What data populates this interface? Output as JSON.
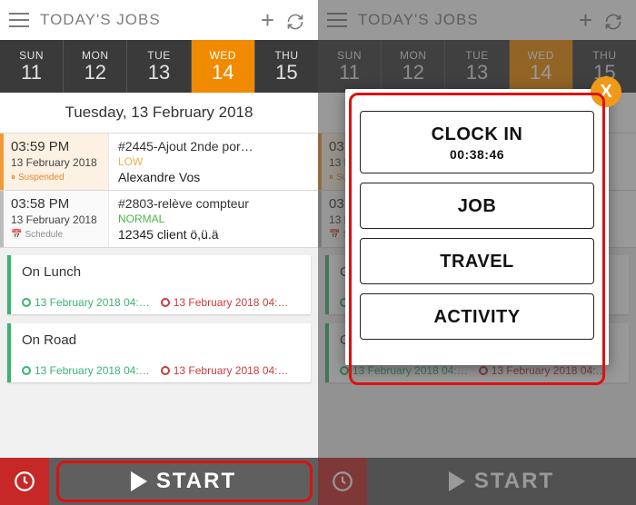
{
  "header": {
    "title": "TODAY'S JOBS"
  },
  "days": [
    {
      "name": "SUN",
      "num": "11"
    },
    {
      "name": "MON",
      "num": "12"
    },
    {
      "name": "TUE",
      "num": "13"
    },
    {
      "name": "WED",
      "num": "14"
    },
    {
      "name": "THU",
      "num": "15"
    }
  ],
  "selected_day_index": 3,
  "date_heading": "Tuesday, 13 February 2018",
  "jobs": [
    {
      "time": "03:59 PM",
      "date": "13 February 2018",
      "status": "Suspended",
      "title": "#2445-Ajout 2nde por…",
      "priority": "LOW",
      "client": "Alexandre Vos"
    },
    {
      "time": "03:58 PM",
      "date": "13 February 2018",
      "status": "Schedule",
      "title": "#2803-relève compteur",
      "priority": "NORMAL",
      "client": "12345 client ö,ü.ä"
    }
  ],
  "activities": [
    {
      "label": "On Lunch",
      "start": "13 February 2018 04:…",
      "end": "13 February 2018 04:…"
    },
    {
      "label": "On Road",
      "start": "13 February 2018 04:…",
      "end": "13 February 2018 04:…"
    }
  ],
  "footer": {
    "start": "START"
  },
  "popup": {
    "clock_in": "CLOCK IN",
    "elapsed": "00:38:46",
    "job": "JOB",
    "travel": "TRAVEL",
    "activity": "ACTIVITY",
    "close": "X"
  }
}
